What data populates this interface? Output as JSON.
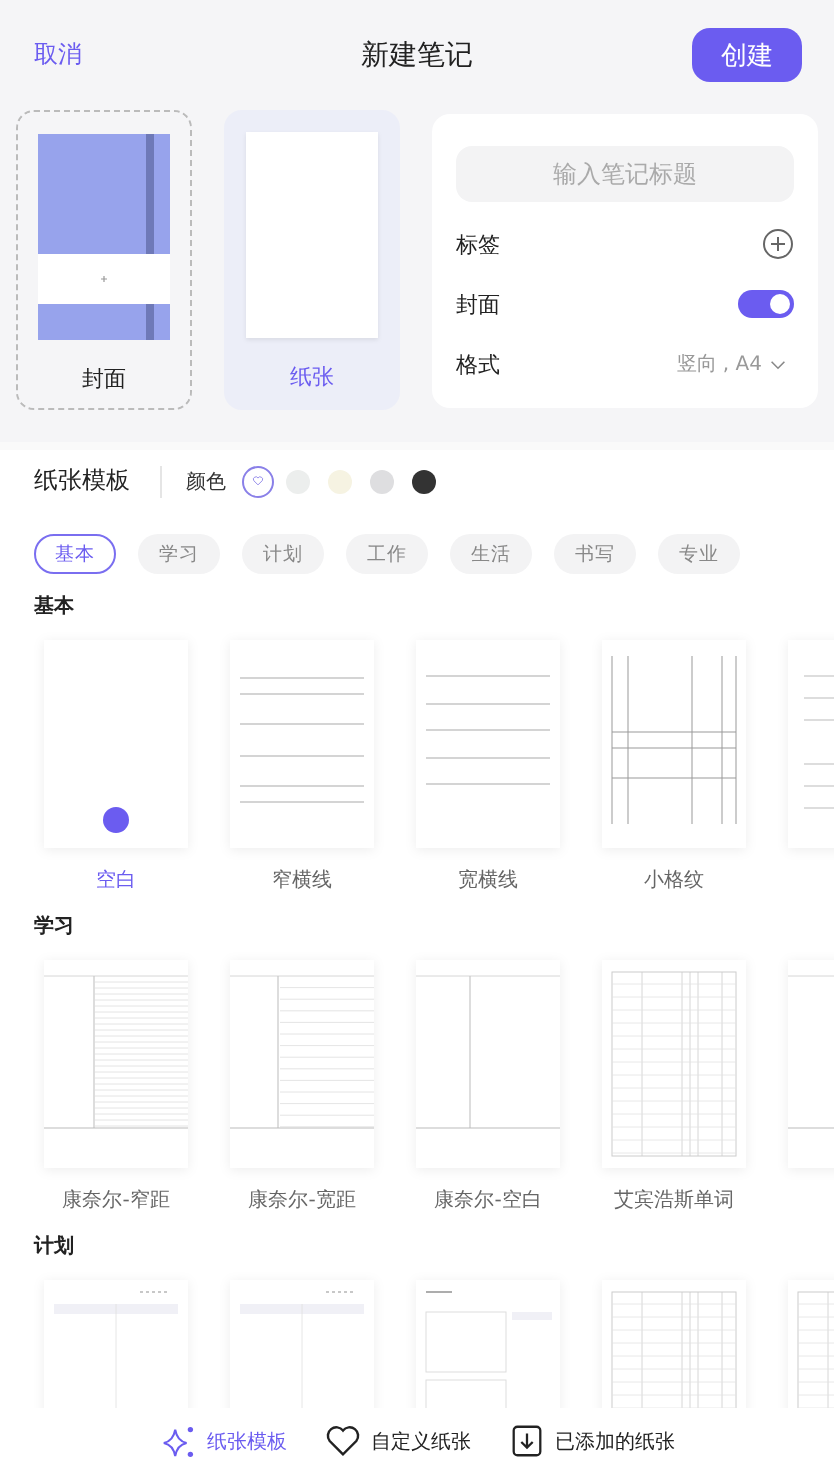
{
  "header": {
    "cancel": "取消",
    "title": "新建笔记",
    "create": "创建"
  },
  "preview": [
    {
      "kind": "cover",
      "label": "封面",
      "selected": false
    },
    {
      "kind": "paper",
      "label": "纸张",
      "selected": true
    }
  ],
  "form": {
    "placeholder": "输入笔记标题",
    "tags_label": "标签",
    "cover_label": "封面",
    "cover_on": true,
    "format_label": "格式",
    "format_value": "竖向 , A4"
  },
  "templates": {
    "title": "纸张模板",
    "color_label": "颜色",
    "colors": [
      {
        "color": "#ffffff",
        "selected": true
      },
      {
        "color": "#eceeed",
        "selected": false
      },
      {
        "color": "#f6f3e2",
        "selected": false
      },
      {
        "color": "#dedee0",
        "selected": false
      },
      {
        "color": "#333333",
        "selected": false
      }
    ],
    "categories": [
      {
        "label": "基本",
        "selected": true
      },
      {
        "label": "学习",
        "selected": false
      },
      {
        "label": "计划",
        "selected": false
      },
      {
        "label": "工作",
        "selected": false
      },
      {
        "label": "生活",
        "selected": false
      },
      {
        "label": "书写",
        "selected": false
      },
      {
        "label": "专业",
        "selected": false
      }
    ]
  },
  "sections": [
    {
      "title": "基本",
      "items": [
        {
          "kind": "blank",
          "label": "空白",
          "selected": true
        },
        {
          "kind": "narrow",
          "label": "窄横线",
          "selected": false
        },
        {
          "kind": "wide",
          "label": "宽横线",
          "selected": false
        },
        {
          "kind": "grid",
          "label": "小格纹",
          "selected": false
        },
        {
          "kind": "mixed"
        }
      ]
    },
    {
      "title": "学习",
      "items": [
        {
          "kind": "cornell-narrow",
          "label": "康奈尔-窄距",
          "selected": false
        },
        {
          "kind": "cornell-wide",
          "label": "康奈尔-宽距",
          "selected": false
        },
        {
          "kind": "cornell-blank",
          "label": "康奈尔-空白",
          "selected": false
        },
        {
          "kind": "table",
          "label": "艾宾浩斯单词",
          "selected": false
        },
        {
          "kind": "cornell-blank"
        }
      ]
    },
    {
      "title": "计划",
      "items": [
        {
          "kind": "planner"
        },
        {
          "kind": "planner"
        },
        {
          "kind": "planner-boxes"
        },
        {
          "kind": "table"
        },
        {
          "kind": "table"
        }
      ]
    }
  ],
  "bottom_tabs": [
    {
      "kind": "sparkle",
      "label": "纸张模板",
      "selected": true
    },
    {
      "kind": "heart",
      "label": "自定义纸张",
      "selected": false
    },
    {
      "kind": "download",
      "label": "已添加的纸张",
      "selected": false
    }
  ]
}
